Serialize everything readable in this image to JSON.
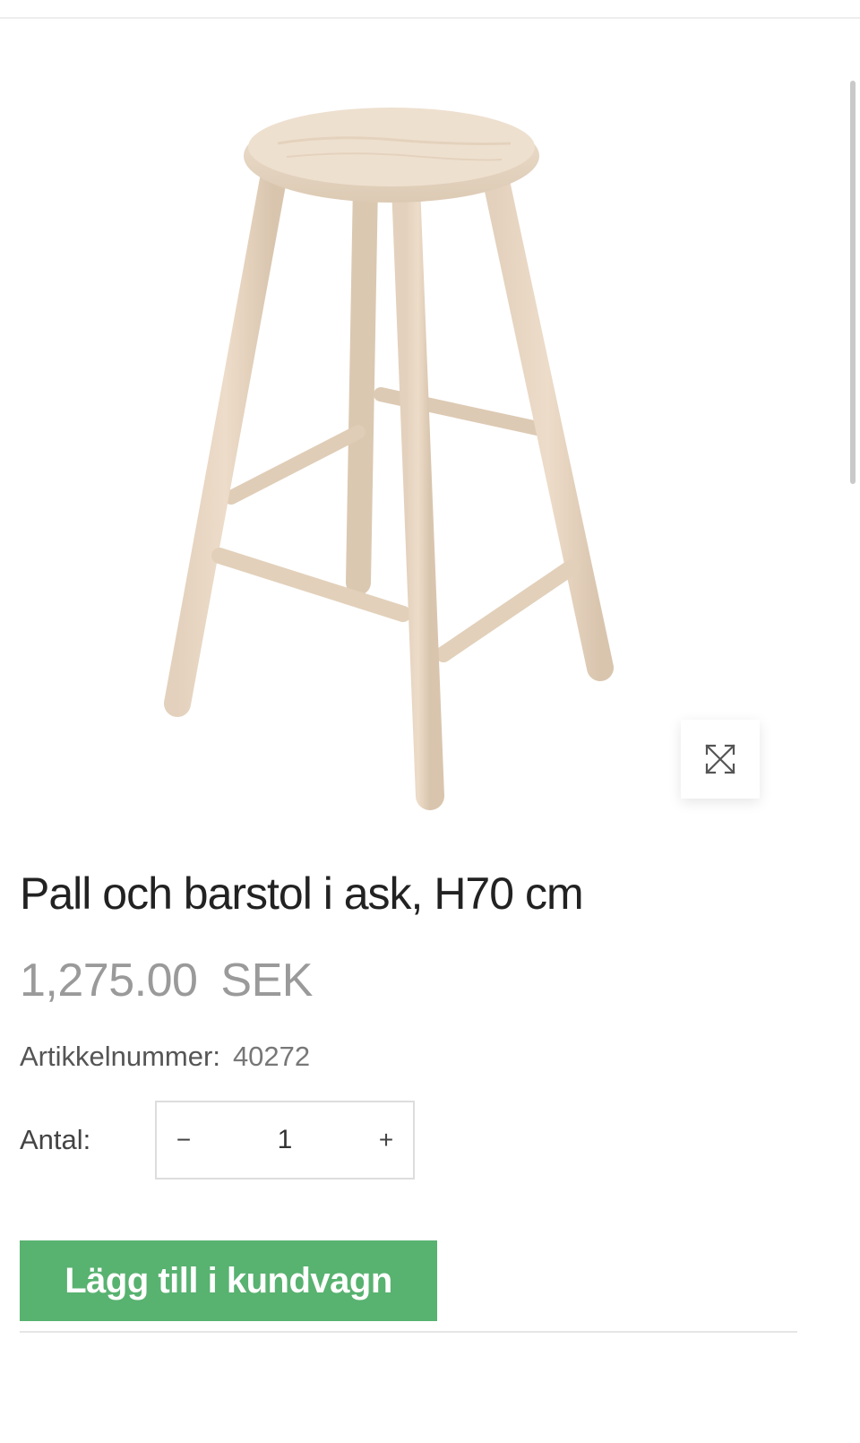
{
  "product": {
    "image_alt": "Pall och barstol i ask",
    "title": "Pall och barstol i ask, H70 cm",
    "price_amount": "1,275.00",
    "price_currency": "SEK",
    "sku_label": "Artikkelnummer:",
    "sku_value": "40272"
  },
  "quantity": {
    "label": "Antal:",
    "value": "1",
    "decrement_label": "−",
    "increment_label": "+"
  },
  "actions": {
    "add_to_cart_label": "Lägg till i kundvagn"
  },
  "icons": {
    "zoom": "expand-arrows-icon"
  },
  "colors": {
    "accent": "#58b270",
    "price": "#9a9a9a"
  }
}
